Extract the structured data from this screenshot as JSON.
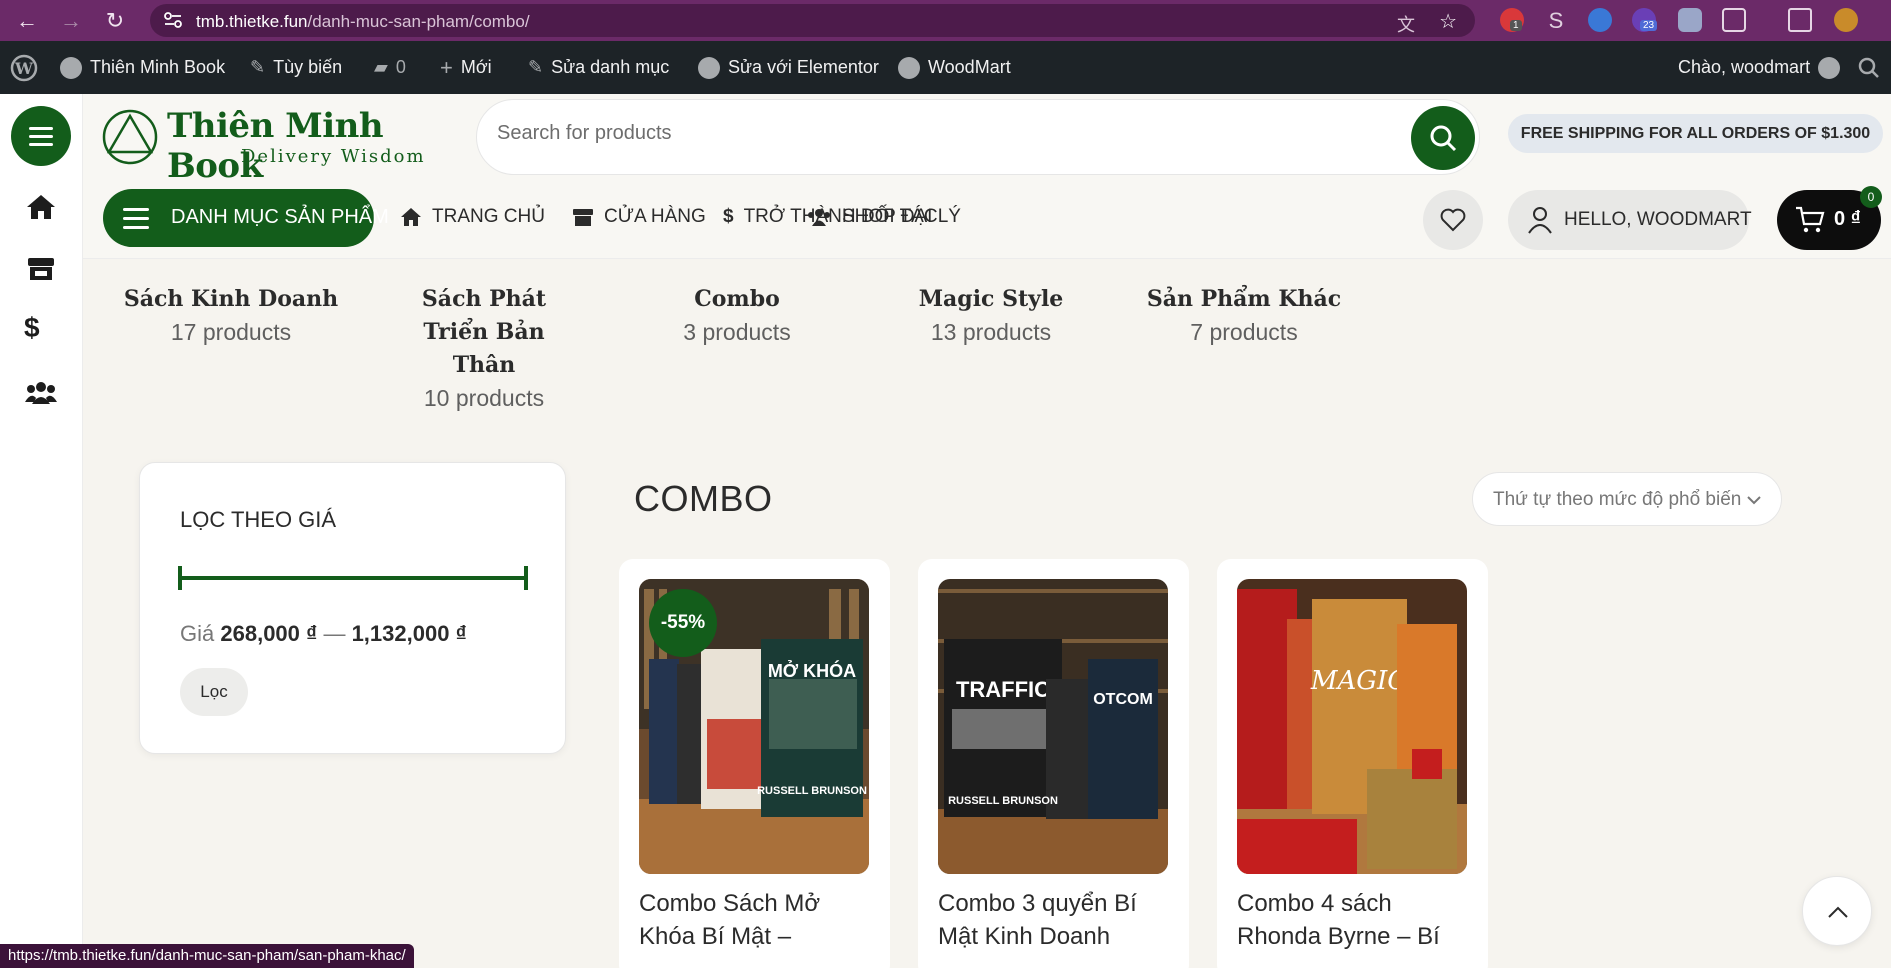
{
  "browser": {
    "url_host": "tmb.thietke.fun",
    "url_path": "/danh-muc-san-pham/combo/",
    "ext_badge_1": "1",
    "ext_badge_2": "23"
  },
  "adminbar": {
    "site_name": "Thiên Minh Book",
    "customize": "Tùy biến",
    "comments_count": "0",
    "new": "Mới",
    "edit_category": "Sửa danh mục",
    "edit_elementor": "Sửa với Elementor",
    "woodmart": "WoodMart",
    "greeting": "Chào, woodmart"
  },
  "header": {
    "logo_title": "Thiên Minh Book",
    "logo_sub": "Delivery Wisdom",
    "search_placeholder": "Search for products",
    "shipping_badge": "FREE SHIPPING FOR ALL ORDERS OF $1.300",
    "categories_button": "DANH MỤC SẢN PHẨM",
    "menu": [
      "TRANG CHỦ",
      "CỬA HÀNG",
      "TRỞ THÀNH ĐỐI TÁC",
      "SHOP ĐẠI LÝ"
    ],
    "account": "HELLO, WOODMART",
    "cart_total": "0 ₫",
    "cart_count": "0"
  },
  "categories": [
    {
      "name": "Sách Kinh Doanh",
      "count": "17 products"
    },
    {
      "name": "Sách Phát Triển Bản Thân",
      "count": "10 products"
    },
    {
      "name": "Combo",
      "count": "3 products"
    },
    {
      "name": "Magic Style",
      "count": "13 products"
    },
    {
      "name": "Sản Phẩm Khác",
      "count": "7 products"
    }
  ],
  "filter": {
    "title": "LỌC THEO GIÁ",
    "price_label": "Giá",
    "min": "268,000 ₫",
    "separator": "—",
    "max": "1,132,000 ₫",
    "range_min_fraction": 0,
    "range_max_fraction": 1,
    "button": "Lọc"
  },
  "main": {
    "title": "COMBO",
    "sort_value": "Thứ tự theo mức độ phổ biến"
  },
  "products": [
    {
      "name": "Combo Sách Mở Khóa Bí Mật –",
      "badge": "-55%"
    },
    {
      "name": "Combo 3 quyển Bí Mật Kinh Doanh",
      "badge": ""
    },
    {
      "name": "Combo 4 sách Rhonda Byrne – Bí",
      "badge": ""
    }
  ],
  "status_url": "https://tmb.thietke.fun/danh-muc-san-pham/san-pham-khac/",
  "colors": {
    "brand_green": "#135d1b",
    "chrome_purple": "#6b2a68",
    "admin_bar": "#1d2327"
  },
  "icons": [
    "back-icon",
    "forward-icon",
    "reload-icon",
    "translate-icon",
    "star-icon",
    "home-icon",
    "store-icon",
    "dollar-icon",
    "users-icon",
    "heart-icon",
    "user-icon",
    "cart-icon",
    "search-icon",
    "chevron-up-icon"
  ]
}
